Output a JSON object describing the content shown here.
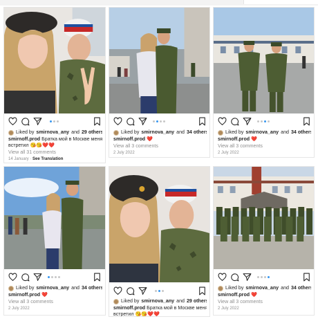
{
  "posts": [
    {
      "liked_prefix": "Liked by",
      "liked_user": "smirnova_any",
      "liked_and": "and",
      "liked_count": "29 others",
      "username": "smirnoff.prod",
      "caption": "Братка мой в Москве меня",
      "caption_line2": "встретил 😘😘❤️❤️",
      "comments": "View all 31 comments",
      "date": "14 January",
      "see_translation": "See Translation",
      "carousel_index": 1,
      "carousel_total": 3
    },
    {
      "liked_prefix": "Liked by",
      "liked_user": "smirnova_any",
      "liked_and": "and",
      "liked_count": "34 others",
      "username": "smirnoff.prod",
      "caption": "❤️",
      "comments": "View all 3 comments",
      "date": "2 July 2022",
      "carousel_index": 2,
      "carousel_total": 4
    },
    {
      "liked_prefix": "Liked by",
      "liked_user": "smirnova_any",
      "liked_and": "and",
      "liked_count": "34 others",
      "username": "smirnoff.prod",
      "caption": "❤️",
      "comments": "View all 3 comments",
      "date": "2 July 2022",
      "carousel_index": 3,
      "carousel_total": 4
    },
    {
      "liked_prefix": "Liked by",
      "liked_user": "smirnova_any",
      "liked_and": "and",
      "liked_count": "34 others",
      "username": "smirnoff.prod",
      "caption": "❤️",
      "comments": "View all 3 comments",
      "date": "2 July 2022",
      "carousel_index": 1,
      "carousel_total": 4
    },
    {
      "liked_prefix": "Liked by",
      "liked_user": "smirnova_any",
      "liked_and": "and",
      "liked_count": "29 others",
      "username": "smirnoff.prod",
      "caption": "Братка мой в Москве меня",
      "caption_line2": "встретил 😘😘❤️❤️",
      "carousel_index": 2,
      "carousel_total": 3
    },
    {
      "liked_prefix": "Liked by",
      "liked_user": "smirnova_any",
      "liked_and": "and",
      "liked_count": "34 others",
      "username": "smirnoff.prod",
      "caption": "❤️",
      "comments": "View all 3 comments",
      "date": "2 July 2022",
      "carousel_index": 4,
      "carousel_total": 4
    }
  ],
  "icons": [
    "heart-icon",
    "comment-icon",
    "share-icon",
    "bookmark-icon"
  ],
  "colors": {
    "dot_active": "#3897f0",
    "dot_inactive": "#c7c7c7",
    "heart": "#e0245e",
    "text": "#262626",
    "muted": "#8e8e8e"
  }
}
